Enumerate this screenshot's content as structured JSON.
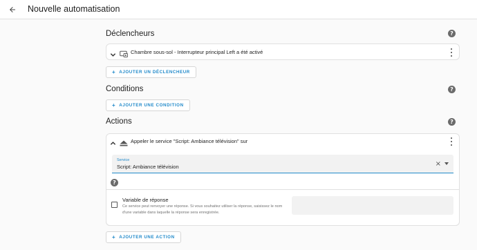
{
  "header": {
    "title": "Nouvelle automatisation"
  },
  "triggers": {
    "title": "Déclencheurs",
    "items": [
      {
        "label": "Chambre sous-sol - Interrupteur principal Left a été activé",
        "icon": "device-icon"
      }
    ],
    "add_label": "AJOUTER UN DÉCLENCHEUR"
  },
  "conditions": {
    "title": "Conditions",
    "add_label": "AJOUTER UNE CONDITION"
  },
  "actions": {
    "title": "Actions",
    "items": [
      {
        "label": "Appeler le service \"Script: Ambiance télévision\" sur",
        "icon": "service-icon",
        "service": {
          "label": "Service",
          "value": "Script: Ambiance télévision"
        },
        "response": {
          "title": "Variable de réponse",
          "description": "Ce service peut renvoyer une réponse. Si vous souhaitez utiliser la réponse, saisissez le nom d'une variable dans laquelle la réponse sera enregistrée."
        }
      }
    ],
    "add_label": "AJOUTER UNE ACTION"
  },
  "colors": {
    "accent": "#1e88c9",
    "background": "#fafafa",
    "card": "#ffffff"
  }
}
